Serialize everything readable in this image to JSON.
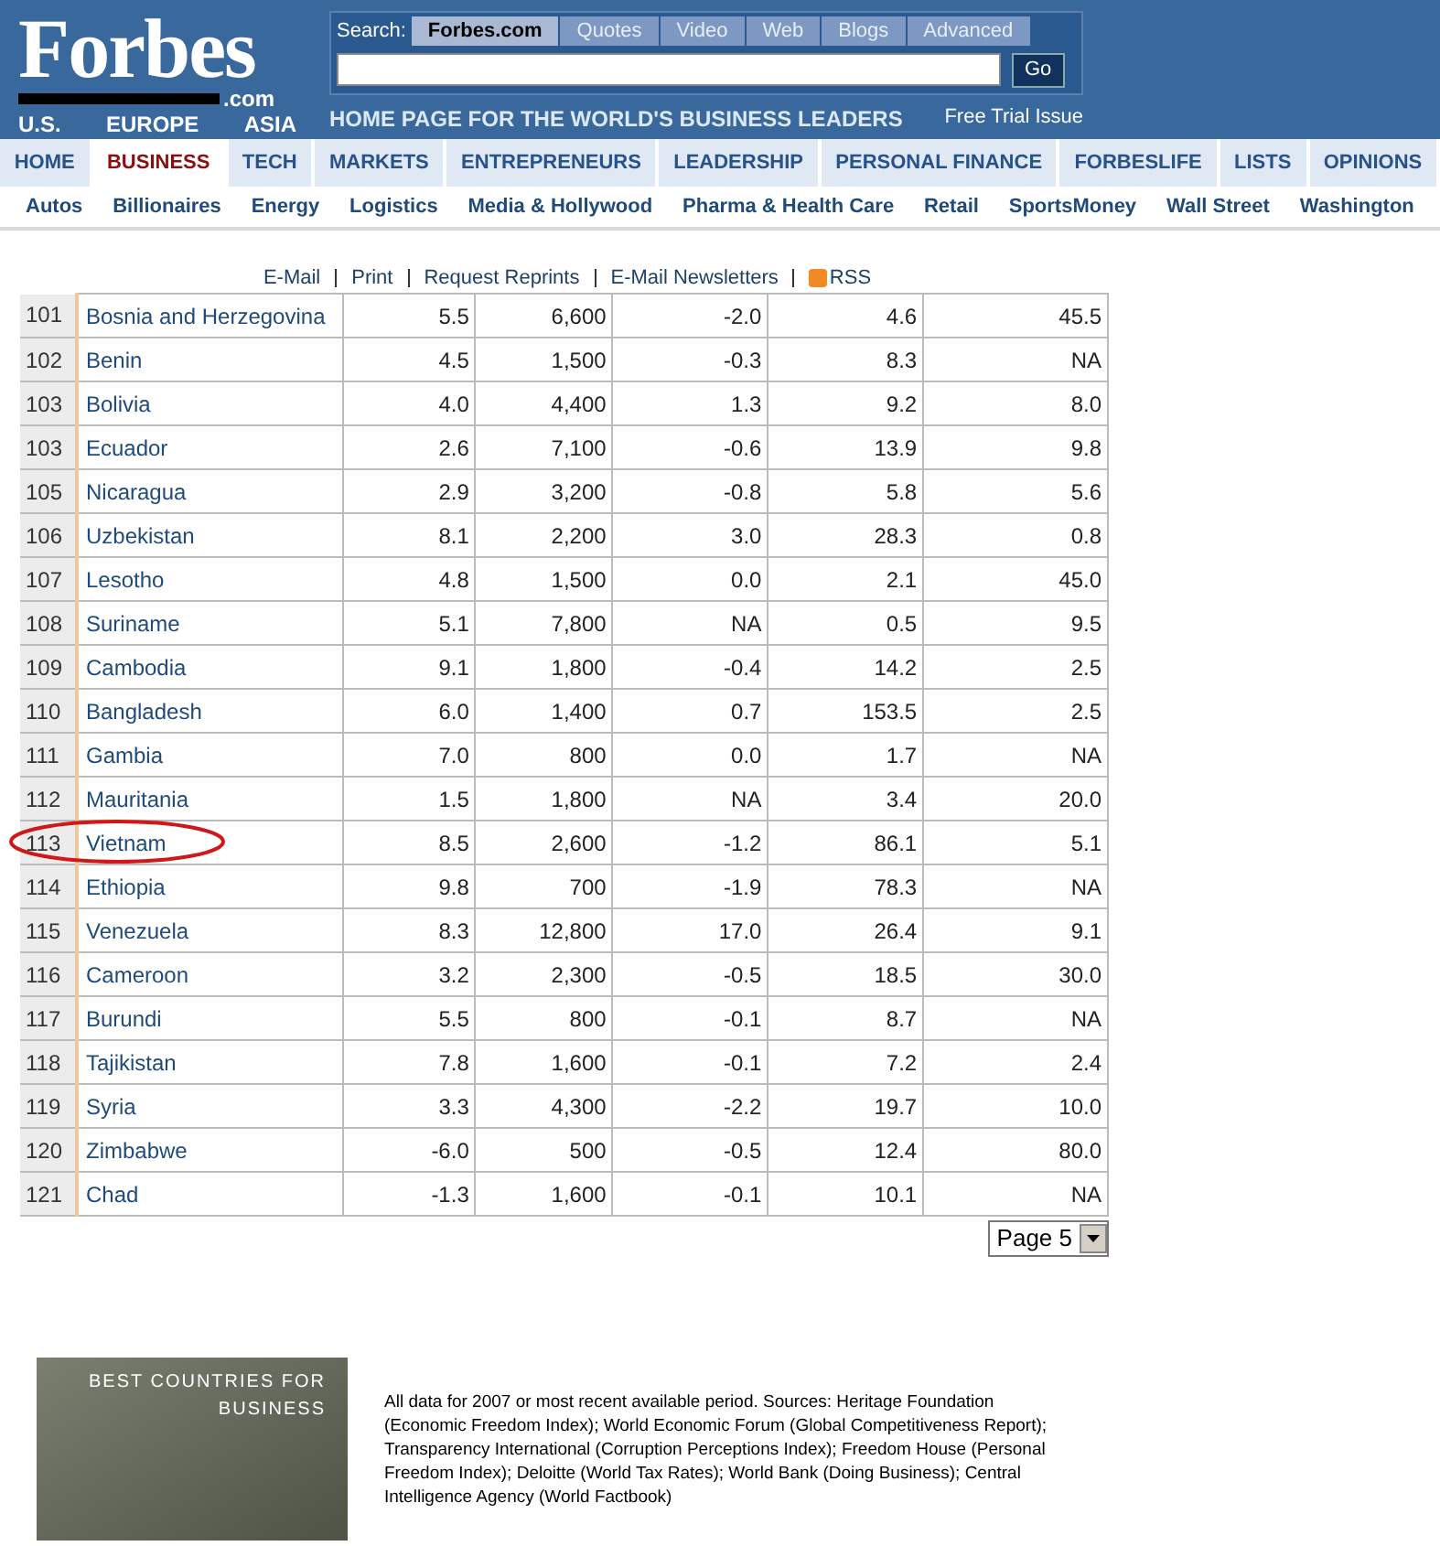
{
  "header": {
    "logo": "Forbes",
    "logo_suffix": ".com",
    "editions": [
      "U.S.",
      "EUROPE",
      "ASIA"
    ],
    "tagline": "HOME PAGE FOR THE WORLD'S BUSINESS LEADERS",
    "promo_link": "Free Trial Issue",
    "search": {
      "label": "Search:",
      "tabs": [
        {
          "label": "Forbes.com",
          "selected": true
        },
        {
          "label": "Quotes",
          "selected": false
        },
        {
          "label": "Video",
          "selected": false
        },
        {
          "label": "Web",
          "selected": false
        },
        {
          "label": "Blogs",
          "selected": false
        },
        {
          "label": "Advanced",
          "selected": false
        }
      ],
      "button": "Go"
    }
  },
  "nav": [
    {
      "label": "HOME",
      "selected": false
    },
    {
      "label": "BUSINESS",
      "selected": true
    },
    {
      "label": "TECH",
      "selected": false
    },
    {
      "label": "MARKETS",
      "selected": false
    },
    {
      "label": "ENTREPRENEURS",
      "selected": false
    },
    {
      "label": "LEADERSHIP",
      "selected": false
    },
    {
      "label": "PERSONAL FINANCE",
      "selected": false
    },
    {
      "label": "FORBESLIFE",
      "selected": false
    },
    {
      "label": "LISTS",
      "selected": false
    },
    {
      "label": "OPINIONS",
      "selected": false
    }
  ],
  "subnav": [
    "Autos",
    "Billionaires",
    "Energy",
    "Logistics",
    "Media & Hollywood",
    "Pharma & Health Care",
    "Retail",
    "SportsMoney",
    "Wall Street",
    "Washington"
  ],
  "tools": [
    "E-Mail",
    "Print",
    "Request Reprints",
    "E-Mail Newsletters",
    "RSS"
  ],
  "table": {
    "rows": [
      {
        "rank": "101",
        "country": "Bosnia and Herzegovina",
        "values": [
          "5.5",
          "6,600",
          "-2.0",
          "4.6",
          "45.5"
        ],
        "circled": false
      },
      {
        "rank": "102",
        "country": "Benin",
        "values": [
          "4.5",
          "1,500",
          "-0.3",
          "8.3",
          "NA"
        ],
        "circled": false
      },
      {
        "rank": "103",
        "country": "Bolivia",
        "values": [
          "4.0",
          "4,400",
          "1.3",
          "9.2",
          "8.0"
        ],
        "circled": false
      },
      {
        "rank": "103",
        "country": "Ecuador",
        "values": [
          "2.6",
          "7,100",
          "-0.6",
          "13.9",
          "9.8"
        ],
        "circled": false
      },
      {
        "rank": "105",
        "country": "Nicaragua",
        "values": [
          "2.9",
          "3,200",
          "-0.8",
          "5.8",
          "5.6"
        ],
        "circled": false
      },
      {
        "rank": "106",
        "country": "Uzbekistan",
        "values": [
          "8.1",
          "2,200",
          "3.0",
          "28.3",
          "0.8"
        ],
        "circled": false
      },
      {
        "rank": "107",
        "country": "Lesotho",
        "values": [
          "4.8",
          "1,500",
          "0.0",
          "2.1",
          "45.0"
        ],
        "circled": false
      },
      {
        "rank": "108",
        "country": "Suriname",
        "values": [
          "5.1",
          "7,800",
          "NA",
          "0.5",
          "9.5"
        ],
        "circled": false
      },
      {
        "rank": "109",
        "country": "Cambodia",
        "values": [
          "9.1",
          "1,800",
          "-0.4",
          "14.2",
          "2.5"
        ],
        "circled": false
      },
      {
        "rank": "110",
        "country": "Bangladesh",
        "values": [
          "6.0",
          "1,400",
          "0.7",
          "153.5",
          "2.5"
        ],
        "circled": false
      },
      {
        "rank": "111",
        "country": "Gambia",
        "values": [
          "7.0",
          "800",
          "0.0",
          "1.7",
          "NA"
        ],
        "circled": false
      },
      {
        "rank": "112",
        "country": "Mauritania",
        "values": [
          "1.5",
          "1,800",
          "NA",
          "3.4",
          "20.0"
        ],
        "circled": false
      },
      {
        "rank": "113",
        "country": "Vietnam",
        "values": [
          "8.5",
          "2,600",
          "-1.2",
          "86.1",
          "5.1"
        ],
        "circled": true
      },
      {
        "rank": "114",
        "country": "Ethiopia",
        "values": [
          "9.8",
          "700",
          "-1.9",
          "78.3",
          "NA"
        ],
        "circled": false
      },
      {
        "rank": "115",
        "country": "Venezuela",
        "values": [
          "8.3",
          "12,800",
          "17.0",
          "26.4",
          "9.1"
        ],
        "circled": false
      },
      {
        "rank": "116",
        "country": "Cameroon",
        "values": [
          "3.2",
          "2,300",
          "-0.5",
          "18.5",
          "30.0"
        ],
        "circled": false
      },
      {
        "rank": "117",
        "country": "Burundi",
        "values": [
          "5.5",
          "800",
          "-0.1",
          "8.7",
          "NA"
        ],
        "circled": false
      },
      {
        "rank": "118",
        "country": "Tajikistan",
        "values": [
          "7.8",
          "1,600",
          "-0.1",
          "7.2",
          "2.4"
        ],
        "circled": false
      },
      {
        "rank": "119",
        "country": "Syria",
        "values": [
          "3.3",
          "4,300",
          "-2.2",
          "19.7",
          "10.0"
        ],
        "circled": false
      },
      {
        "rank": "120",
        "country": "Zimbabwe",
        "values": [
          "-6.0",
          "500",
          "-0.5",
          "12.4",
          "80.0"
        ],
        "circled": false
      },
      {
        "rank": "121",
        "country": "Chad",
        "values": [
          "-1.3",
          "1,600",
          "-0.1",
          "10.1",
          "NA"
        ],
        "circled": false
      }
    ]
  },
  "pager": {
    "value": "Page 5"
  },
  "banner": {
    "title": "BEST COUNTRIES FOR",
    "subtitle": "BUSINESS"
  },
  "sources": "All data for 2007 or most recent available period. Sources: Heritage Foundation (Economic Freedom Index); World Economic Forum (Global Competitiveness Report); Transparency International (Corruption Perceptions Index); Freedom House (Personal Freedom Index); Deloitte (World Tax Rates); World Bank (Doing Business); Central Intelligence Agency (World Factbook)"
}
